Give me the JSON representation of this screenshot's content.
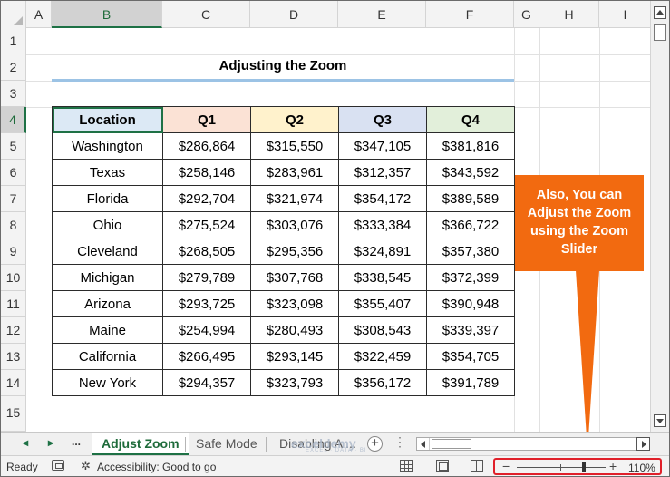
{
  "columns": [
    "A",
    "B",
    "C",
    "D",
    "E",
    "F",
    "G",
    "H",
    "I"
  ],
  "rows": [
    "1",
    "2",
    "3",
    "4",
    "5",
    "6",
    "7",
    "8",
    "9",
    "10",
    "11",
    "12",
    "13",
    "14",
    "15"
  ],
  "title": "Adjusting the Zoom",
  "table": {
    "headers": [
      "Location",
      "Q1",
      "Q2",
      "Q3",
      "Q4"
    ],
    "rows": [
      [
        "Washington",
        "$286,864",
        "$315,550",
        "$347,105",
        "$381,816"
      ],
      [
        "Texas",
        "$258,146",
        "$283,961",
        "$312,357",
        "$343,592"
      ],
      [
        "Florida",
        "$292,704",
        "$321,974",
        "$354,172",
        "$389,589"
      ],
      [
        "Ohio",
        "$275,524",
        "$303,076",
        "$333,384",
        "$366,722"
      ],
      [
        "Cleveland",
        "$268,505",
        "$295,356",
        "$324,891",
        "$357,380"
      ],
      [
        "Michigan",
        "$279,789",
        "$307,768",
        "$338,545",
        "$372,399"
      ],
      [
        "Arizona",
        "$293,725",
        "$323,098",
        "$355,407",
        "$390,948"
      ],
      [
        "Maine",
        "$254,994",
        "$280,493",
        "$308,543",
        "$339,397"
      ],
      [
        "California",
        "$266,495",
        "$293,145",
        "$322,459",
        "$354,705"
      ],
      [
        "New York",
        "$294,357",
        "$323,793",
        "$356,172",
        "$391,789"
      ]
    ]
  },
  "callout": {
    "lines": [
      "Also, You can",
      "Adjust the Zoom",
      "using the Zoom",
      "Slider"
    ],
    "color": "#f26a10"
  },
  "tabs": {
    "nav_prev": "◂",
    "nav_next": "▸",
    "more": "...",
    "items": [
      "Adjust Zoom",
      "Safe Mode",
      "Disabling A ..."
    ],
    "active": "Adjust Zoom",
    "add": "+"
  },
  "watermark": {
    "main": "exceldemy",
    "sub": "EXCEL · DATA · BI"
  },
  "status": {
    "ready": "Ready",
    "accessibility": "Accessibility: Good to go",
    "zoom_minus": "−",
    "zoom_plus": "+",
    "zoom_percent": "110%",
    "zoom_level": 110
  },
  "colors": {
    "accent": "#1e7145",
    "header_location": "#dce9f5",
    "header_q1": "#fbe2d5",
    "header_q2": "#fff2cc",
    "header_q3": "#d9e1f2",
    "header_q4": "#e2efda",
    "zoom_highlight": "#e0202a",
    "title_rule": "#9cc3e5"
  }
}
